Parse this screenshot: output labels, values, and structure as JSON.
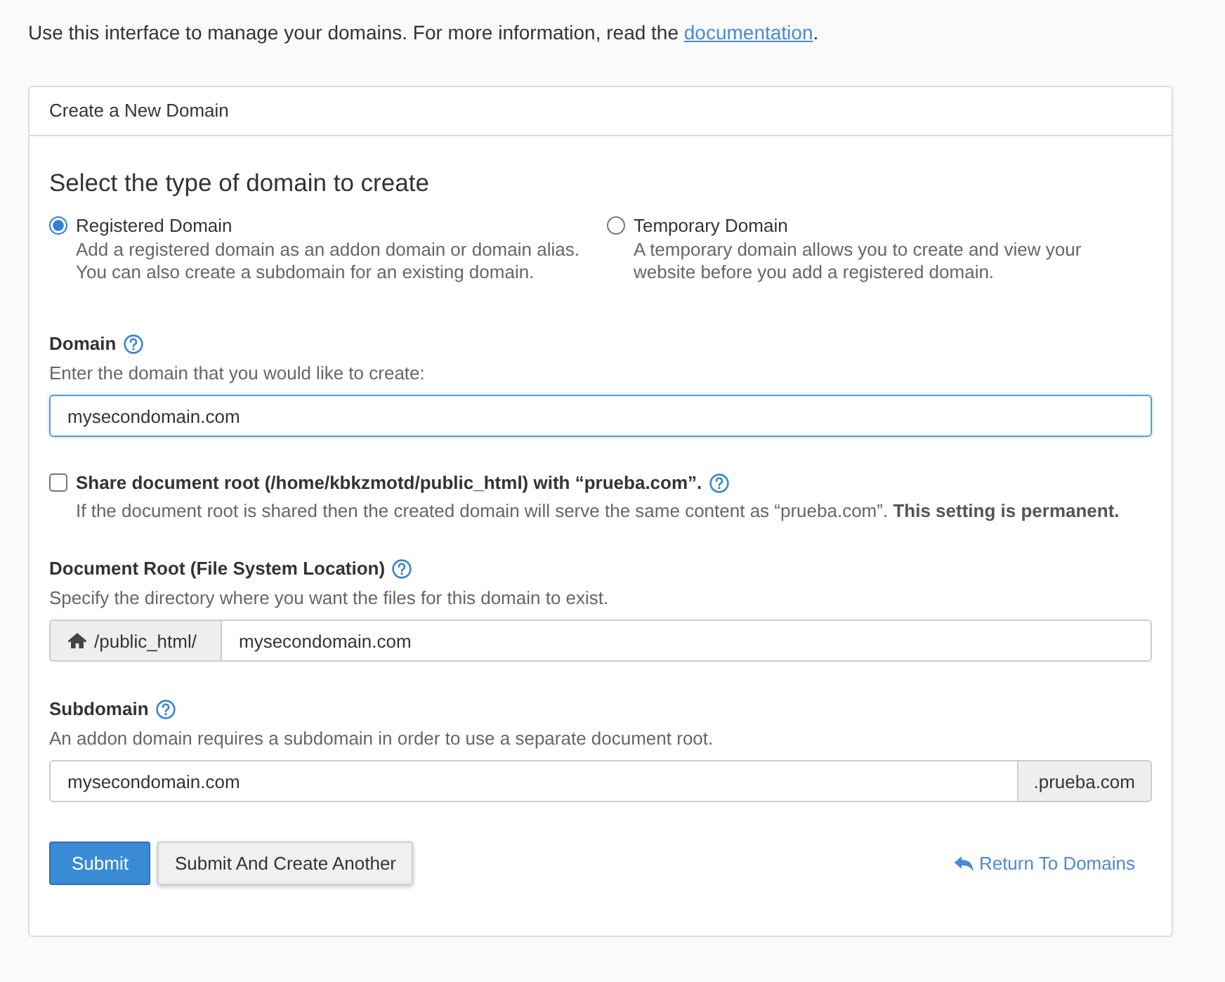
{
  "intro": {
    "text": "Use this interface to manage your domains. For more information, read the",
    "link": "documentation",
    "end": "."
  },
  "panel": {
    "title": "Create a New Domain",
    "heading": "Select the type of domain to create",
    "domain_types": [
      {
        "label": "Registered Domain",
        "description": "Add a registered domain as an addon domain or domain alias. You can also create a subdomain for an existing domain.",
        "selected": true
      },
      {
        "label": "Temporary Domain",
        "description": "A temporary domain allows you to create and view your website before you add a registered domain.",
        "selected": false
      }
    ],
    "domain": {
      "label": "Domain",
      "hint": "Enter the domain that you would like to create:",
      "value": "mysecondomain.com",
      "focused": true
    },
    "share_root": {
      "label": "Share document root (/home/kbkzmotd/public_html) with “prueba.com”.",
      "checked": false,
      "note": "If the document root is shared then the created domain will serve the same content as “prueba.com”. **This setting is permanent.**"
    },
    "document_root": {
      "label": "Document Root (File System Location)",
      "hint": "Specify the directory where you want the files for this domain to exist.",
      "prefix": "/public_html/",
      "value": "mysecondomain.com",
      "focused": false
    },
    "subdomain": {
      "label": "Subdomain",
      "hint": "An addon domain requires a subdomain in order to use a separate document root.",
      "value": "mysecondomain.com",
      "suffix": ".prueba.com",
      "focused": false
    },
    "buttons": [
      {
        "label": "Submit",
        "kind": "primary"
      },
      {
        "label": "Submit And Create Another",
        "kind": "default"
      }
    ],
    "return_link": "Return To Domains"
  }
}
